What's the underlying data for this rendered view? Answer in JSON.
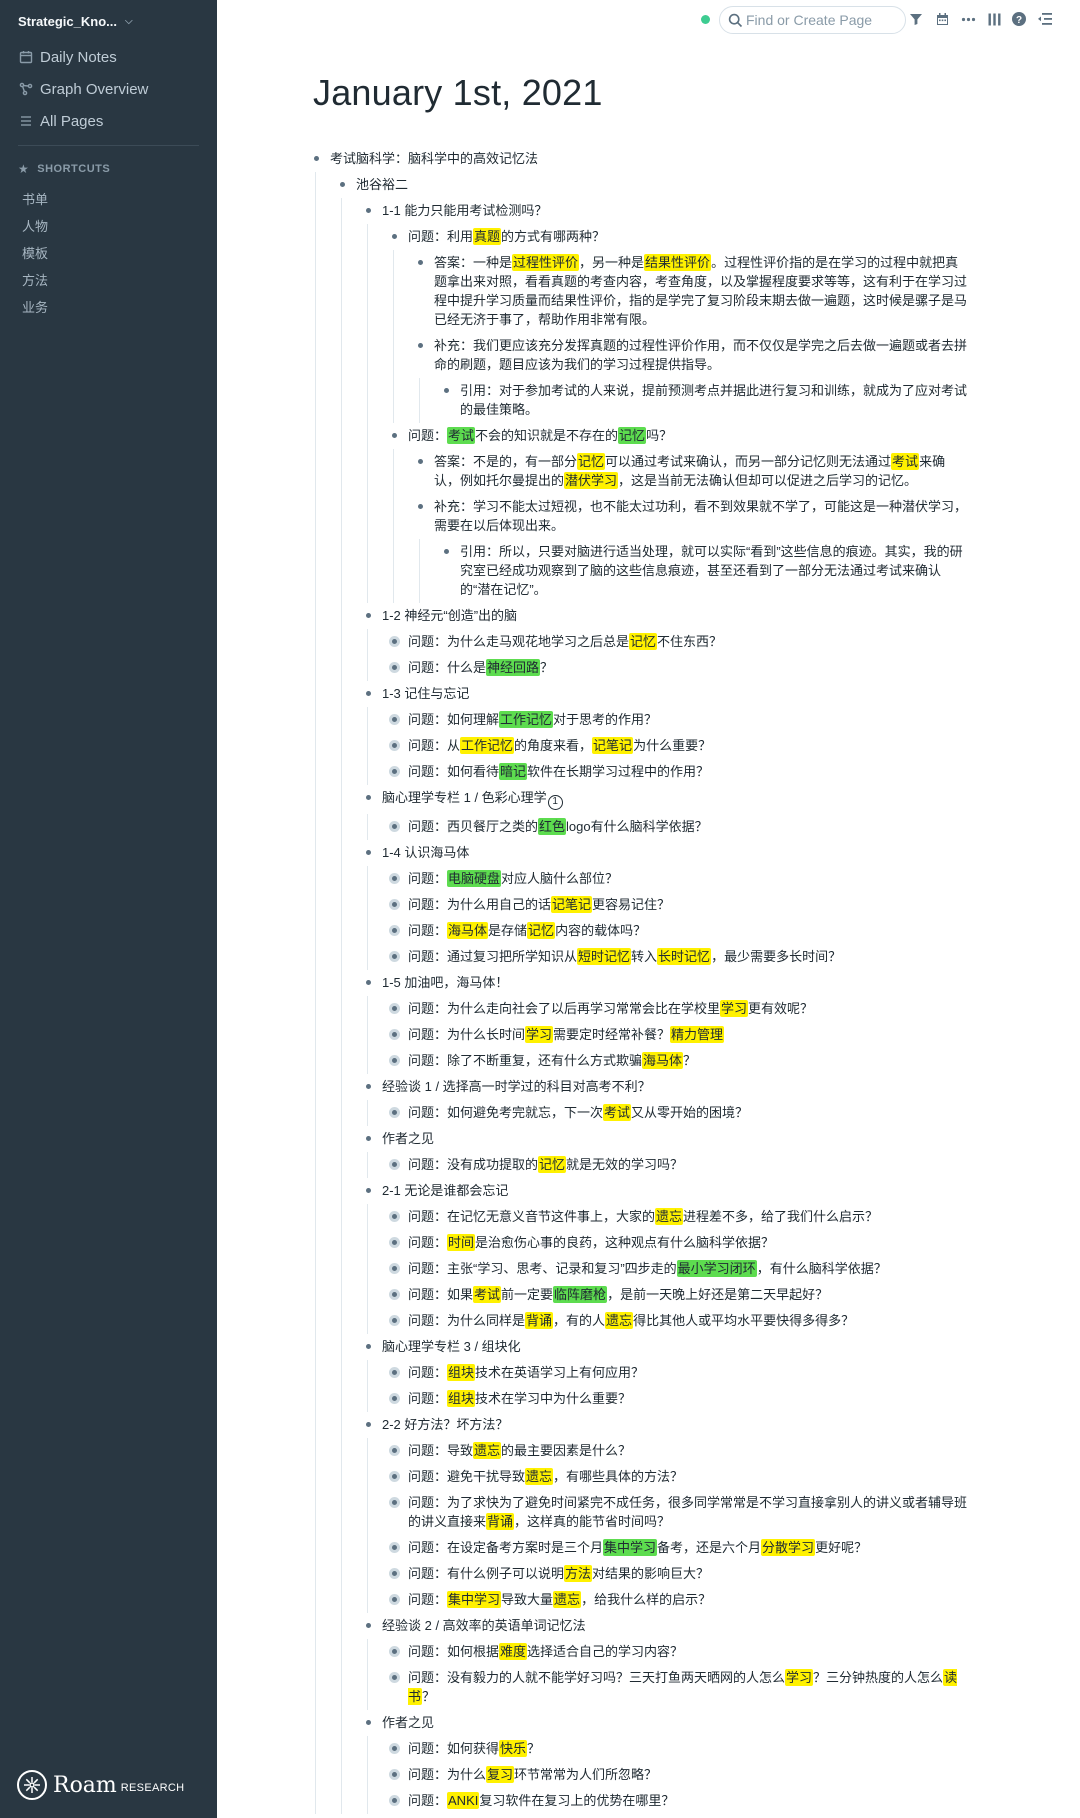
{
  "sidebar": {
    "graph_name": "Strategic_Kno...",
    "nav": [
      {
        "label": "Daily Notes",
        "icon": "calendar-icon"
      },
      {
        "label": "Graph Overview",
        "icon": "graph-icon"
      },
      {
        "label": "All Pages",
        "icon": "list-icon"
      }
    ],
    "shortcuts_header": "SHORTCUTS",
    "shortcuts": [
      "书单",
      "人物",
      "模板",
      "方法",
      "业务"
    ],
    "logo_word": "Roam",
    "logo_sub": "RESEARCH"
  },
  "topbar": {
    "search_placeholder": "Find or Create Page",
    "icons": [
      "filter-icon",
      "calendar-icon",
      "more-icon",
      "sidebar-toggle-icon",
      "help-icon",
      "outline-icon"
    ],
    "status_color": "#3dcc91"
  },
  "page": {
    "title": "January 1st, 2021"
  },
  "outline": [
    {
      "t": "考试脑科学：脑科学中的高效记忆法",
      "c": [
        {
          "t": "池谷裕二",
          "c": [
            {
              "t": "1-1 能力只能用考试检测吗？",
              "c": [
                {
                  "t": "问题：利用[[真题]]的方式有哪两种？",
                  "c": [
                    {
                      "t": "答案：一种是[[过程性评价]]，另一种是[[结果性评价]]。过程性评价指的是在学习的过程中就把真题拿出来对照，看看真题的考查内容，考查角度，以及掌握程度要求等等，这有利于在学习过程中提升学习质量而结果性评价，指的是学完了复习阶段末期去做一遍题，这时候是骡子是马已经无济于事了，帮助作用非常有限。"
                    },
                    {
                      "t": "补充：我们更应该充分发挥真题的过程性评价作用，而不仅仅是学完之后去做一遍题或者去拼命的刷题，题目应该为我们的学习过程提供指导。",
                      "c": [
                        {
                          "t": "引用：对于参加考试的人来说，提前预测考点并据此进行复习和训练，就成为了应对考试的最佳策略。"
                        }
                      ]
                    }
                  ]
                },
                {
                  "t": "问题：{{考试}}不会的知识就是不存在的{{记忆}}吗？",
                  "c": [
                    {
                      "t": "答案：不是的，有一部分[[记忆]]可以通过考试来确认，而另一部分记忆则无法通过[[考试]]来确认，例如托尔曼提出的[[潜伏学习]]，这是当前无法确认但却可以促进之后学习的记忆。"
                    },
                    {
                      "t": "补充：学习不能太过短视，也不能太过功利，看不到效果就不学了，可能这是一种潜伏学习，需要在以后体现出来。",
                      "c": [
                        {
                          "t": "引用：所以，只要对脑进行适当处理，就可以实际“看到”这些信息的痕迹。其实，我的研究室已经成功观察到了脑的这些信息痕迹，甚至还看到了一部分无法通过考试来确认的“潜在记忆”。"
                        }
                      ]
                    }
                  ]
                }
              ]
            },
            {
              "t": "1-2 神经元“创造”出的脑",
              "c": [
                {
                  "t": "问题：为什么走马观花地学习之后总是[[记忆]]不住东西？",
                  "x": 1
                },
                {
                  "t": "问题：什么是{{神经回路}}？",
                  "x": 1
                }
              ]
            },
            {
              "t": "1-3 记住与忘记",
              "c": [
                {
                  "t": "问题：如何理解{{工作记忆}}对于思考的作用？",
                  "x": 1
                },
                {
                  "t": "问题：从[[工作记忆]]的角度来看，[[记笔记]]为什么重要？",
                  "x": 1
                },
                {
                  "t": "问题：如何看待{{暗记}}软件在长期学习过程中的作用？",
                  "x": 1
                }
              ]
            },
            {
              "t": "脑心理学专栏 1 / 色彩心理学①",
              "c": [
                {
                  "t": "问题：西贝餐厅之类的{{红色}}logo有什么脑科学依据？",
                  "x": 1
                }
              ]
            },
            {
              "t": "1-4 认识海马体",
              "c": [
                {
                  "t": "问题：{{电脑硬盘}}对应人脑什么部位？",
                  "x": 1
                },
                {
                  "t": "问题：为什么用自己的话[[记笔记]]更容易记住？",
                  "x": 1
                },
                {
                  "t": "问题：[[海马体]]是存储[[记忆]]内容的载体吗？",
                  "x": 1
                },
                {
                  "t": "问题：通过复习把所学知识从[[短时记忆]]转入[[长时记忆]]，最少需要多长时间？",
                  "x": 1
                }
              ]
            },
            {
              "t": "1-5 加油吧，海马体！",
              "c": [
                {
                  "t": "问题：为什么走向社会了以后再学习常常会比在学校里[[学习]]更有效呢？",
                  "x": 1
                },
                {
                  "t": "问题：为什么长时间[[学习]]需要定时经常补餐？[[精力管理]]",
                  "x": 1
                },
                {
                  "t": "问题：除了不断重复，还有什么方式欺骗[[海马体]]？",
                  "x": 1
                }
              ]
            },
            {
              "t": "经验谈 1 / 选择高一时学过的科目对高考不利？",
              "c": [
                {
                  "t": "问题：如何避免考完就忘，下一次[[考试]]又从零开始的困境？",
                  "x": 1
                }
              ]
            },
            {
              "t": "作者之见",
              "c": [
                {
                  "t": "问题：没有成功提取的[[记忆]]就是无效的学习吗？",
                  "x": 1
                }
              ]
            },
            {
              "t": "2-1 无论是谁都会忘记",
              "c": [
                {
                  "t": "问题：在记忆无意义音节这件事上，大家的[[遗忘]]进程差不多，给了我们什么启示？",
                  "x": 1
                },
                {
                  "t": "问题：[[时间]]是治愈伤心事的良药，这种观点有什么脑科学依据？",
                  "x": 1
                },
                {
                  "t": "问题：主张“学习、思考、记录和复习”四步走的{{最小学习闭环}}，有什么脑科学依据？",
                  "x": 1
                },
                {
                  "t": "问题：如果[[考试]]前一定要{{临阵磨枪}}，是前一天晚上好还是第二天早起好？",
                  "x": 1
                },
                {
                  "t": "问题：为什么同样是[[背诵]]，有的人[[遗忘]]得比其他人或平均水平要快得多得多？",
                  "x": 1
                }
              ]
            },
            {
              "t": "脑心理学专栏 3 / 组块化",
              "c": [
                {
                  "t": "问题：[[组块]]技术在英语学习上有何应用？",
                  "x": 1
                },
                {
                  "t": "问题：[[组块]]技术在学习中为什么重要？",
                  "x": 1
                }
              ]
            },
            {
              "t": "2-2 好方法？坏方法？",
              "c": [
                {
                  "t": "问题：导致[[遗忘]]的最主要因素是什么？",
                  "x": 1
                },
                {
                  "t": "问题：避免干扰导致[[遗忘]]，有哪些具体的方法？",
                  "x": 1
                },
                {
                  "t": "问题：为了求快为了避免时间紧完不成任务，很多同学常常是不学习直接拿别人的讲义或者辅导班的讲义直接来[[背诵]]，这样真的能节省时间吗？",
                  "x": 1
                },
                {
                  "t": "问题：在设定备考方案时是三个月{{集中学习}}备考，还是六个月[[分散学习]]更好呢？",
                  "x": 1
                },
                {
                  "t": "问题：有什么例子可以说明[[方法]]对结果的影响巨大？",
                  "x": 1
                },
                {
                  "t": "问题：[[集中学习]]导致大量[[遗忘]]，给我什么样的启示？",
                  "x": 1
                }
              ]
            },
            {
              "t": "经验谈 2 / 高效率的英语单词记忆法",
              "c": [
                {
                  "t": "问题：如何根据[[难度]]选择适合自己的学习内容？",
                  "x": 1
                },
                {
                  "t": "问题：没有毅力的人就不能学好习吗？三天打鱼两天晒网的人怎么[[学习]]？三分钟热度的人怎么[[读书]]？",
                  "x": 1
                }
              ]
            },
            {
              "t": "作者之见",
              "c": [
                {
                  "t": "问题：如何获得[[快乐]]？",
                  "x": 1
                },
                {
                  "t": "问题：为什么[[复习]]环节常常为人们所忽略？",
                  "x": 1
                },
                {
                  "t": "问题：[[ANKI]]复习软件在复习上的优势在哪里？",
                  "x": 1
                }
              ]
            }
          ]
        }
      ]
    }
  ]
}
